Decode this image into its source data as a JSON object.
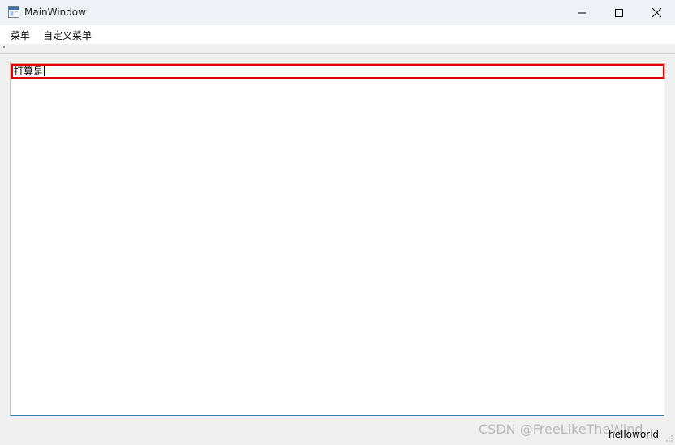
{
  "window": {
    "title": "MainWindow",
    "icon": "app-window-icon",
    "controls": [
      "minimize-icon",
      "maximize-icon",
      "close-icon"
    ]
  },
  "menubar": {
    "items": [
      {
        "label": "菜单"
      },
      {
        "label": "自定义菜单"
      }
    ]
  },
  "editor": {
    "line_edit_value": "打算是"
  },
  "statusbar": {
    "message": "helloworld"
  },
  "watermark": {
    "text": "CSDN @FreeLikeTheWind."
  },
  "colors": {
    "line_edit_border": "#e10000",
    "titlebar_bg": "#eef2f7",
    "central_bottom_border": "#3b7ea6"
  }
}
